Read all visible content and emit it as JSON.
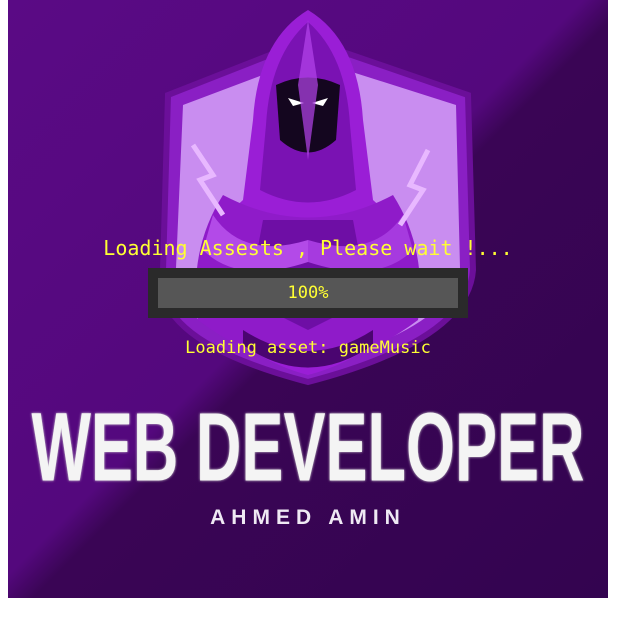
{
  "splash": {
    "title": "WEB DEVELOPER",
    "subtitle": "AHMED AMIN",
    "logo_icon": "hooded-figure-shield-icon"
  },
  "loader": {
    "message": "Loading Assests , Please wait !...",
    "progress_label": "100%",
    "progress_fraction": 1.0,
    "status_text": "Loading asset: gameMusic"
  },
  "colors": {
    "background_purple": "#54087d",
    "background_dark_purple": "#330450",
    "loader_text": "#ffff33",
    "progress_fill": "#565656",
    "progress_frame": "#2a2a2a"
  }
}
